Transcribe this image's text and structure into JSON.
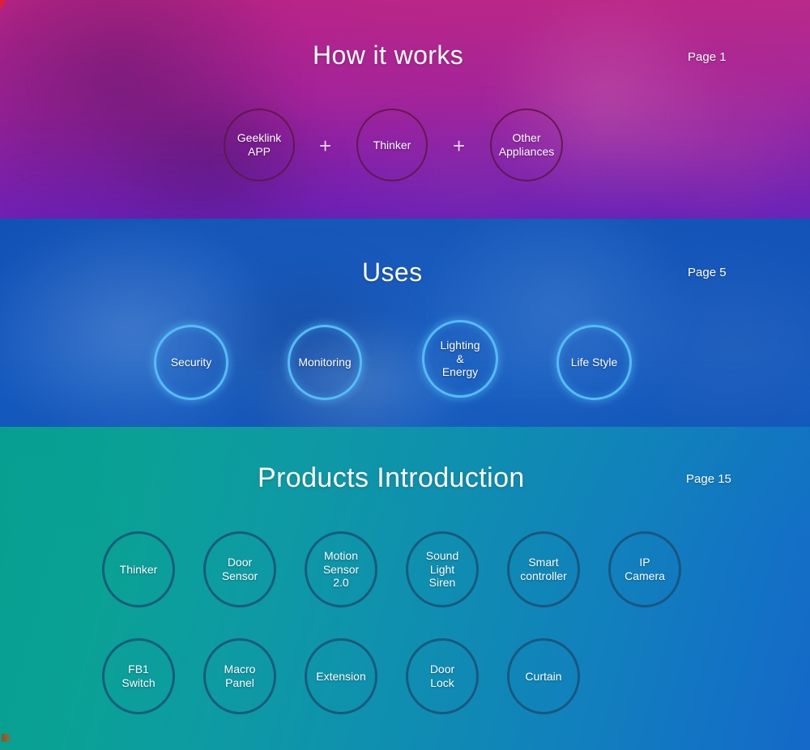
{
  "sections": [
    {
      "id": "how-it-works",
      "title": "How it works",
      "page_label": "Page 1",
      "accent_color": "#5c1846",
      "items": [
        {
          "label": "Geeklink\nAPP"
        },
        {
          "label": "Thinker"
        },
        {
          "label": "Other\nAppliances"
        }
      ],
      "separators": [
        "+",
        "+"
      ]
    },
    {
      "id": "uses",
      "title": "Uses",
      "page_label": "Page 5",
      "accent_color": "#55bdf5",
      "items": [
        {
          "label": "Security"
        },
        {
          "label": "Monitoring"
        },
        {
          "label": "Lighting\n&\nEnergy"
        },
        {
          "label": "Life Style"
        }
      ]
    },
    {
      "id": "products-introduction",
      "title": "Products Introduction",
      "page_label": "Page 15",
      "accent_color": "#1c4c70",
      "rows": [
        [
          {
            "label": "Thinker"
          },
          {
            "label": "Door\nSensor"
          },
          {
            "label": "Motion\nSensor\n2.0"
          },
          {
            "label": "Sound\nLight\nSiren"
          },
          {
            "label": "Smart\ncontroller"
          },
          {
            "label": "IP\nCamera"
          }
        ],
        [
          {
            "label": "FB1\nSwitch"
          },
          {
            "label": "Macro\nPanel"
          },
          {
            "label": "Extension"
          },
          {
            "label": "Door\nLock"
          },
          {
            "label": "Curtain"
          }
        ]
      ]
    }
  ]
}
